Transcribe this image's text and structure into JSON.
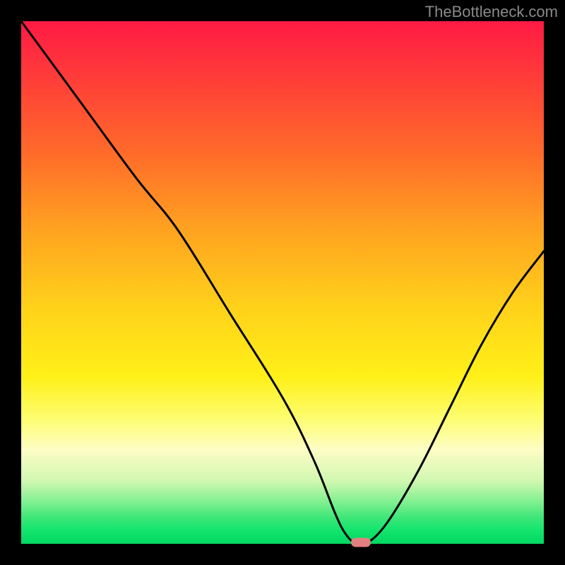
{
  "watermark": "TheBottleneck.com",
  "chart_data": {
    "type": "line",
    "title": "",
    "xlabel": "",
    "ylabel": "",
    "xlim": [
      0,
      100
    ],
    "ylim": [
      0,
      100
    ],
    "x": [
      0,
      11,
      22,
      30,
      40,
      50,
      56,
      60,
      62,
      64,
      66,
      70,
      76,
      82,
      88,
      94,
      100
    ],
    "values": [
      100,
      85,
      70,
      60,
      44,
      28,
      16,
      6,
      2,
      0,
      0,
      4,
      14,
      26,
      38,
      48,
      56
    ],
    "minimum_point": {
      "x": 65,
      "y": 0
    },
    "gradient_zones": [
      {
        "label": "severe-bottleneck",
        "color": "#ff1a44"
      },
      {
        "label": "high-bottleneck",
        "color": "#ff6a2a"
      },
      {
        "label": "moderate-bottleneck",
        "color": "#ffd21a"
      },
      {
        "label": "low-bottleneck",
        "color": "#fdfdc5"
      },
      {
        "label": "optimal",
        "color": "#00d862"
      }
    ]
  }
}
